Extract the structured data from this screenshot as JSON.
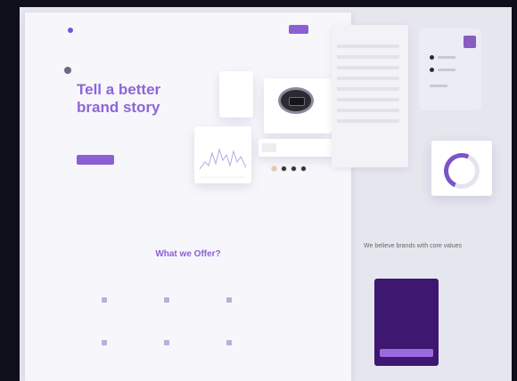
{
  "hero": {
    "title": "Tell a better brand story",
    "description": "",
    "cta_label": "",
    "link_label": ""
  },
  "offer": {
    "title": "What we Offer?",
    "description": ""
  },
  "right_panel": {
    "heading": "We believe brands with core values"
  },
  "colors": {
    "accent": "#8d5fd3",
    "promo_bg": "#3d1770",
    "page_bg": "#f7f7fb"
  },
  "icons": [
    "logo-icon",
    "menu-icon",
    "watch-image",
    "chart-icon",
    "gauge-icon"
  ]
}
